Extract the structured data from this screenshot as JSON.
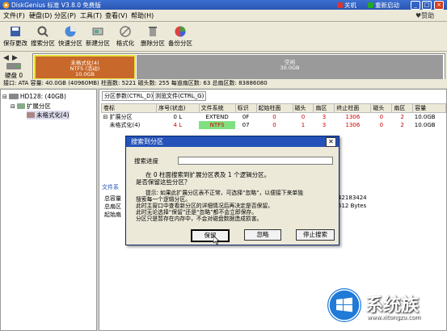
{
  "window": {
    "title": "DiskGenius 标准 V3.8.0 免费版",
    "shutdown_label": "关机",
    "restart_label": "重新启动",
    "help_label": "赞助"
  },
  "menu": [
    "文件(F)",
    "硬盘(D)",
    "分区(P)",
    "工具(T)",
    "查看(V)",
    "帮助(H)"
  ],
  "toolbar": [
    {
      "label": "保存更改",
      "icon": "save-icon"
    },
    {
      "label": "搜索分区",
      "icon": "search-icon"
    },
    {
      "label": "快速分区",
      "icon": "quick-partition-icon"
    },
    {
      "label": "新建分区",
      "icon": "new-partition-icon"
    },
    {
      "label": "格式化",
      "icon": "format-icon"
    },
    {
      "label": "删除分区",
      "icon": "delete-icon"
    },
    {
      "label": "备份分区",
      "icon": "backup-icon"
    }
  ],
  "diskmap": {
    "disk_label": "硬盘 0",
    "seg1": {
      "line1": "未格式化(4)",
      "line2": "NTFS (活动)",
      "line3": "10.0GB",
      "color": "#c8682a"
    },
    "seg2": {
      "line1": "空闲",
      "line2": "30.0GB",
      "color": "#9a9a9a"
    }
  },
  "infobar": "接口: ATA  容量: 40.0GB (40960MB)  柱面数: 5221  磁头数: 255  每道扇区数: 63  总扇区数: 83886080",
  "tree": {
    "disk": "HD128: (40GB)",
    "extended": "扩展分区",
    "partition": "未格式化(4)"
  },
  "tabs": [
    "分区参数(CTRL_D)",
    "浏览文件(CTRL_G)"
  ],
  "table": {
    "headers": [
      "卷标",
      "序号(状态)",
      "文件系统",
      "标识",
      "起始柱面",
      "磁头",
      "扇区",
      "终止柱面",
      "磁头",
      "扇区",
      "容量"
    ],
    "rows": [
      [
        "扩展分区",
        "0 L",
        "EXTEND",
        "0F",
        "0",
        "0",
        "3",
        "1306",
        "0",
        "2",
        "10.0GB"
      ],
      [
        "未格式化(4)",
        "4 L",
        "NTFS",
        "07",
        "0",
        "1",
        "3",
        "1306",
        "0",
        "2",
        "10.0GB"
      ]
    ]
  },
  "side_info": {
    "heading": "文件系",
    "line1": "总容量",
    "line2": "总扇区",
    "line3": "起始扇",
    "value1": "42183424",
    "value2": "512 Bytes"
  },
  "dialog": {
    "title": "搜索到分区",
    "progress_label": "搜索进度",
    "lines": [
      "在 0 柱面搜索到扩展分区表及 1 个逻辑分区。",
      "是否保留这些分区？"
    ],
    "hint_lines": [
      "提示: 如果此扩展分区表不正常，可选择“忽略”，以便接下来单独",
      "搜索每一个逻辑分区。",
      "   此时主窗口中查看新分区的详细情况后再决定是否保留。",
      "   此时无论选择“保留”还是“忽略”都不会立即保存。",
      "   分区只是暂存在内存中，不会对磁盘数据造成损害。"
    ],
    "btn_keep": "保留",
    "btn_ignore": "忽略",
    "btn_stop": "停止搜索"
  },
  "watermark": {
    "text": "系统族",
    "url": "www.xitongzu.com"
  }
}
